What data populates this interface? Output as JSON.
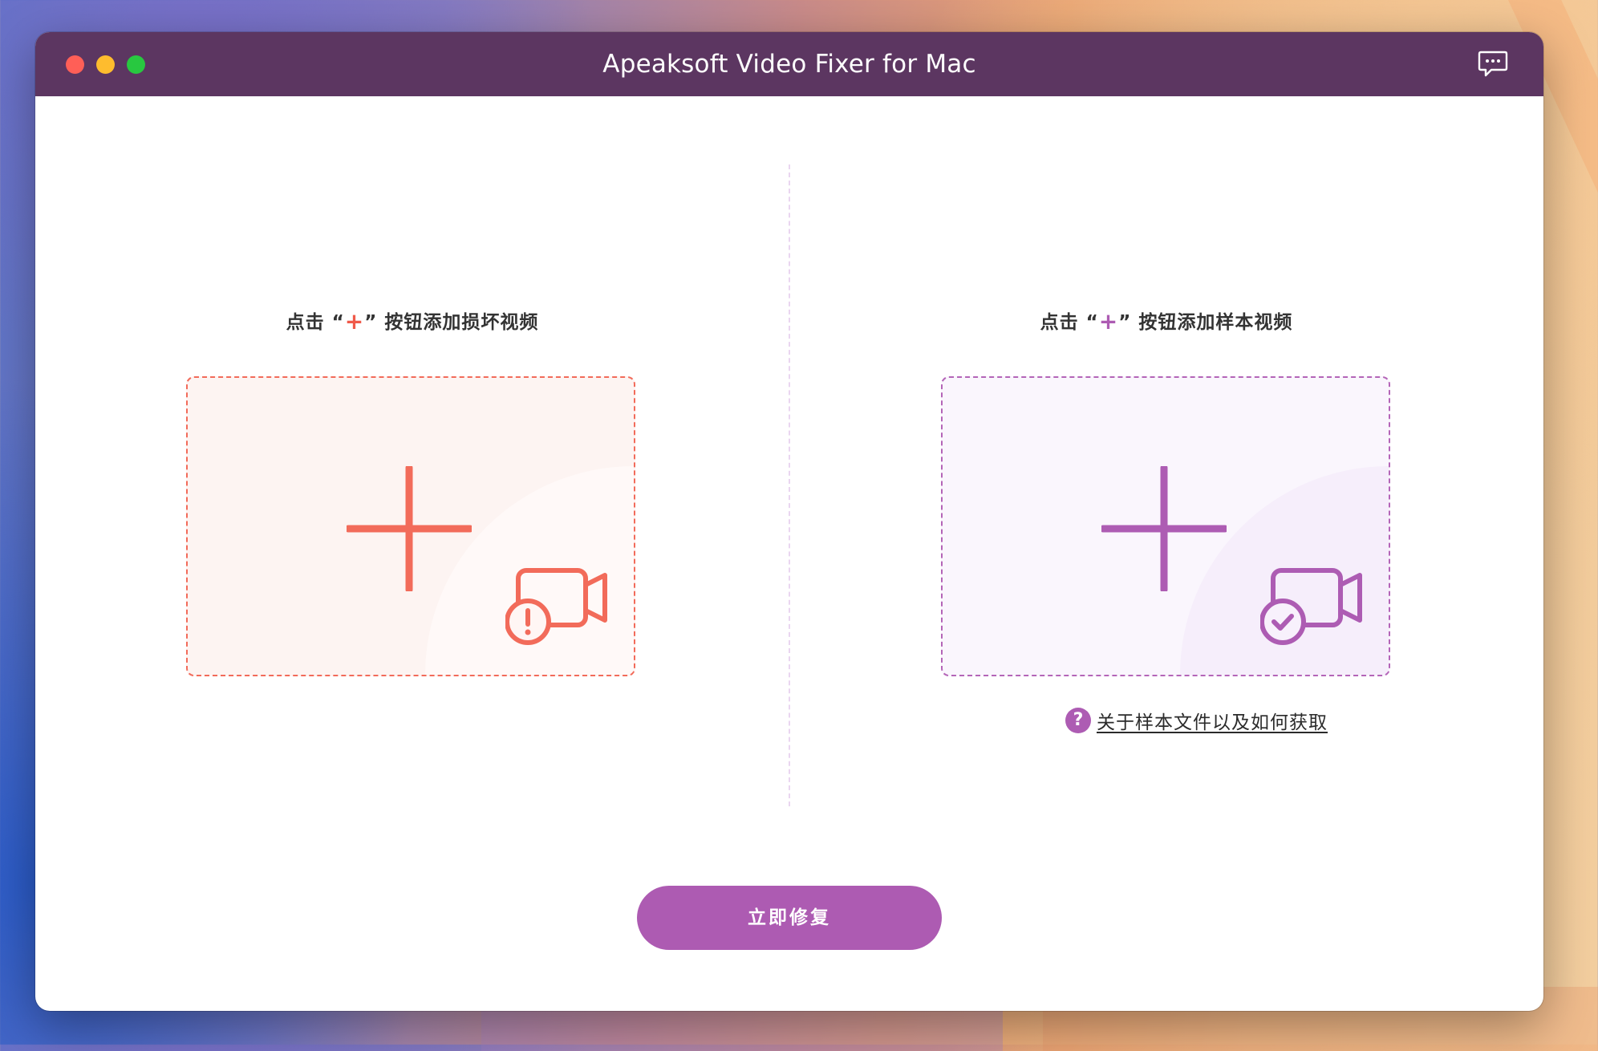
{
  "window": {
    "title": "Apeaksoft Video Fixer for Mac"
  },
  "left_panel": {
    "instruction_prefix": "点击 “",
    "instruction_plus": "+",
    "instruction_suffix": "” 按钮添加损坏视频",
    "accent_color": "#f26b5a"
  },
  "right_panel": {
    "instruction_prefix": "点击 “",
    "instruction_plus": "+",
    "instruction_suffix": "” 按钮添加样本视频",
    "accent_color": "#ad5cb3",
    "help_icon_text": "?",
    "help_link": "关于样本文件以及如何获取"
  },
  "actions": {
    "repair_label": "立即修复",
    "button_color": "#ad5bb2"
  },
  "icons": {
    "feedback": "chat-bubble-icon",
    "damaged_video": "video-camera-warning-icon",
    "sample_video": "video-camera-check-icon"
  }
}
